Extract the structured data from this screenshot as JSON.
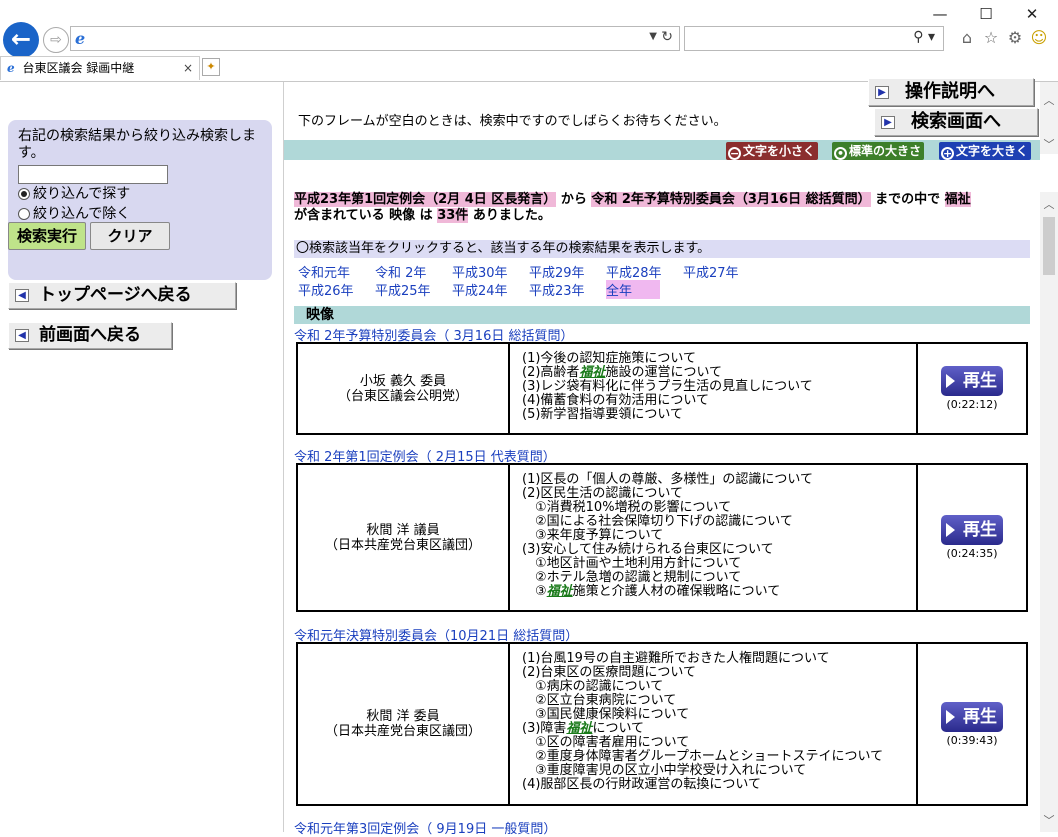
{
  "browser": {
    "tab_title": "台東区議会 録画中継",
    "close_tab": "×",
    "win_min": "—",
    "win_max": "☐",
    "win_close": "✕"
  },
  "left": {
    "filter_desc": "右記の検索結果から絞り込み検索します。",
    "filter_input_value": "",
    "radio_include": "絞り込んで探す",
    "radio_exclude": "絞り込んで除く",
    "exec_button": "検索実行",
    "clear_button": "クリア",
    "top_page_button": "トップページへ戻る",
    "prev_page_button": "前画面へ戻る"
  },
  "right": {
    "manual_button": "操作説明へ",
    "search_screen_button": "検索画面へ",
    "wait_message": "下のフレームが空白のときは、検索中ですのでしばらくお待ちください。",
    "size_small": "文字を小さく",
    "size_standard": "標準の大きさ",
    "size_large": "文字を大きく",
    "summary": {
      "from_range": "平成23年第1回定例会（2月 4日 区長発言）",
      "from_word": "から",
      "to_range": "令和 2年予算特別委員会（3月16日 総括質問）",
      "to_word": "までの中で",
      "keyword": "福祉",
      "line2_pre": "が含まれている 映像 は",
      "count": "33件",
      "line2_post": "ありました。"
    },
    "year_hint": "〇検索該当年をクリックすると、該当する年の検索結果を表示します。",
    "years_row1": [
      "令和元年",
      "令和 2年",
      "平成30年",
      "平成29年",
      "平成28年",
      "平成27年"
    ],
    "years_row2": [
      "平成26年",
      "平成25年",
      "平成24年",
      "平成23年",
      "全年"
    ],
    "section_title": "映像",
    "records": [
      {
        "meeting": "令和 2年予算特別委員会（ 3月16日 総括質問）",
        "speaker_name": "小坂 義久 委員",
        "speaker_party": "（台東区議会公明党）",
        "topics": [
          "(1)今後の認知症施策について",
          "(2)高齢者福祉施設の運営について",
          "(3)レジ袋有料化に伴うプラ生活の見直しについて",
          "(4)備蓄食料の有効活用について",
          "(5)新学習指導要領について"
        ],
        "play_label": "再生",
        "duration": "(0:22:12)"
      },
      {
        "meeting": "令和 2年第1回定例会（ 2月15日 代表質問）",
        "speaker_name": "秋間 洋 議員",
        "speaker_party": "（日本共産党台東区議団）",
        "topics": [
          "(1)区長の「個人の尊厳、多様性」の認識について",
          "(2)区民生活の認識について",
          "　①消費税10%増税の影響について",
          "　②国による社会保障切り下げの認識について",
          "　③来年度予算について",
          "(3)安心して住み続けられる台東区について",
          "　①地区計画や土地利用方針について",
          "　②ホテル急増の認識と規制について",
          "　③福祉施策と介護人材の確保戦略について"
        ],
        "play_label": "再生",
        "duration": "(0:24:35)"
      },
      {
        "meeting": "令和元年決算特別委員会（10月21日 総括質問）",
        "speaker_name": "秋間 洋 委員",
        "speaker_party": "（日本共産党台東区議団）",
        "topics": [
          "(1)台風19号の自主避難所でおきた人権問題について",
          "(2)台東区の医療問題について",
          "　①病床の認識について",
          "　②区立台東病院について",
          "　③国民健康保険料について",
          "(3)障害福祉について",
          "　①区の障害者雇用について",
          "　②重度身体障害者グループホームとショートステイについて",
          "　③重度障害児の区立小中学校受け入れについて",
          "(4)服部区長の行財政運営の転換について"
        ],
        "play_label": "再生",
        "duration": "(0:39:43)"
      }
    ],
    "next_meeting": "令和元年第3回定例会（ 9月19日 一般質問）"
  },
  "colors": {
    "accent_blue": "#1a64c8",
    "filter_box": "#d8d8f0",
    "band_teal": "#b0d8d8",
    "highlight_pink": "#f0b8d8",
    "keyword_green": "#1a7a1a"
  }
}
